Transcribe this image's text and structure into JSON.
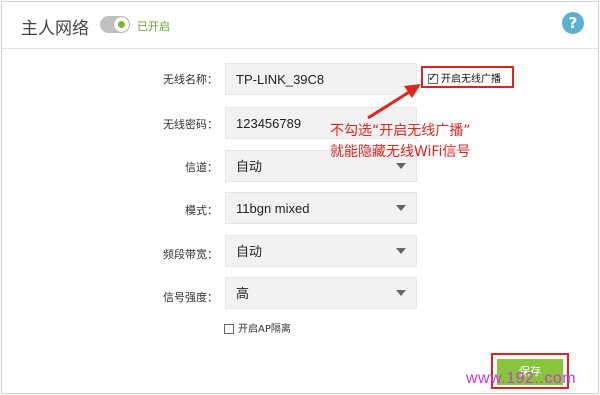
{
  "header": {
    "title": "主人网络",
    "toggle_state": "已开启"
  },
  "form": {
    "ssid_label": "无线名称：",
    "ssid_value": "TP-LINK_39C8",
    "password_label": "无线密码：",
    "password_value": "123456789",
    "channel_label": "信道：",
    "channel_value": "自动",
    "mode_label": "模式：",
    "mode_value": "11bgn mixed",
    "bandwidth_label": "频段带宽：",
    "bandwidth_value": "自动",
    "signal_label": "信号强度：",
    "signal_value": "高",
    "broadcast_label": "开启无线广播",
    "isolation_label": "开启AP隔离",
    "save_label": "保存"
  },
  "annotation": {
    "line1": "不勾选“开启无线广播”",
    "line2": "就能隐藏无线WiFi信号"
  },
  "watermark": "www.192..com",
  "colors": {
    "accent_green": "#88c43d",
    "annotation_red": "#e0261f",
    "help_blue": "#5bb0d6",
    "watermark_purple": "#c63dd0"
  }
}
